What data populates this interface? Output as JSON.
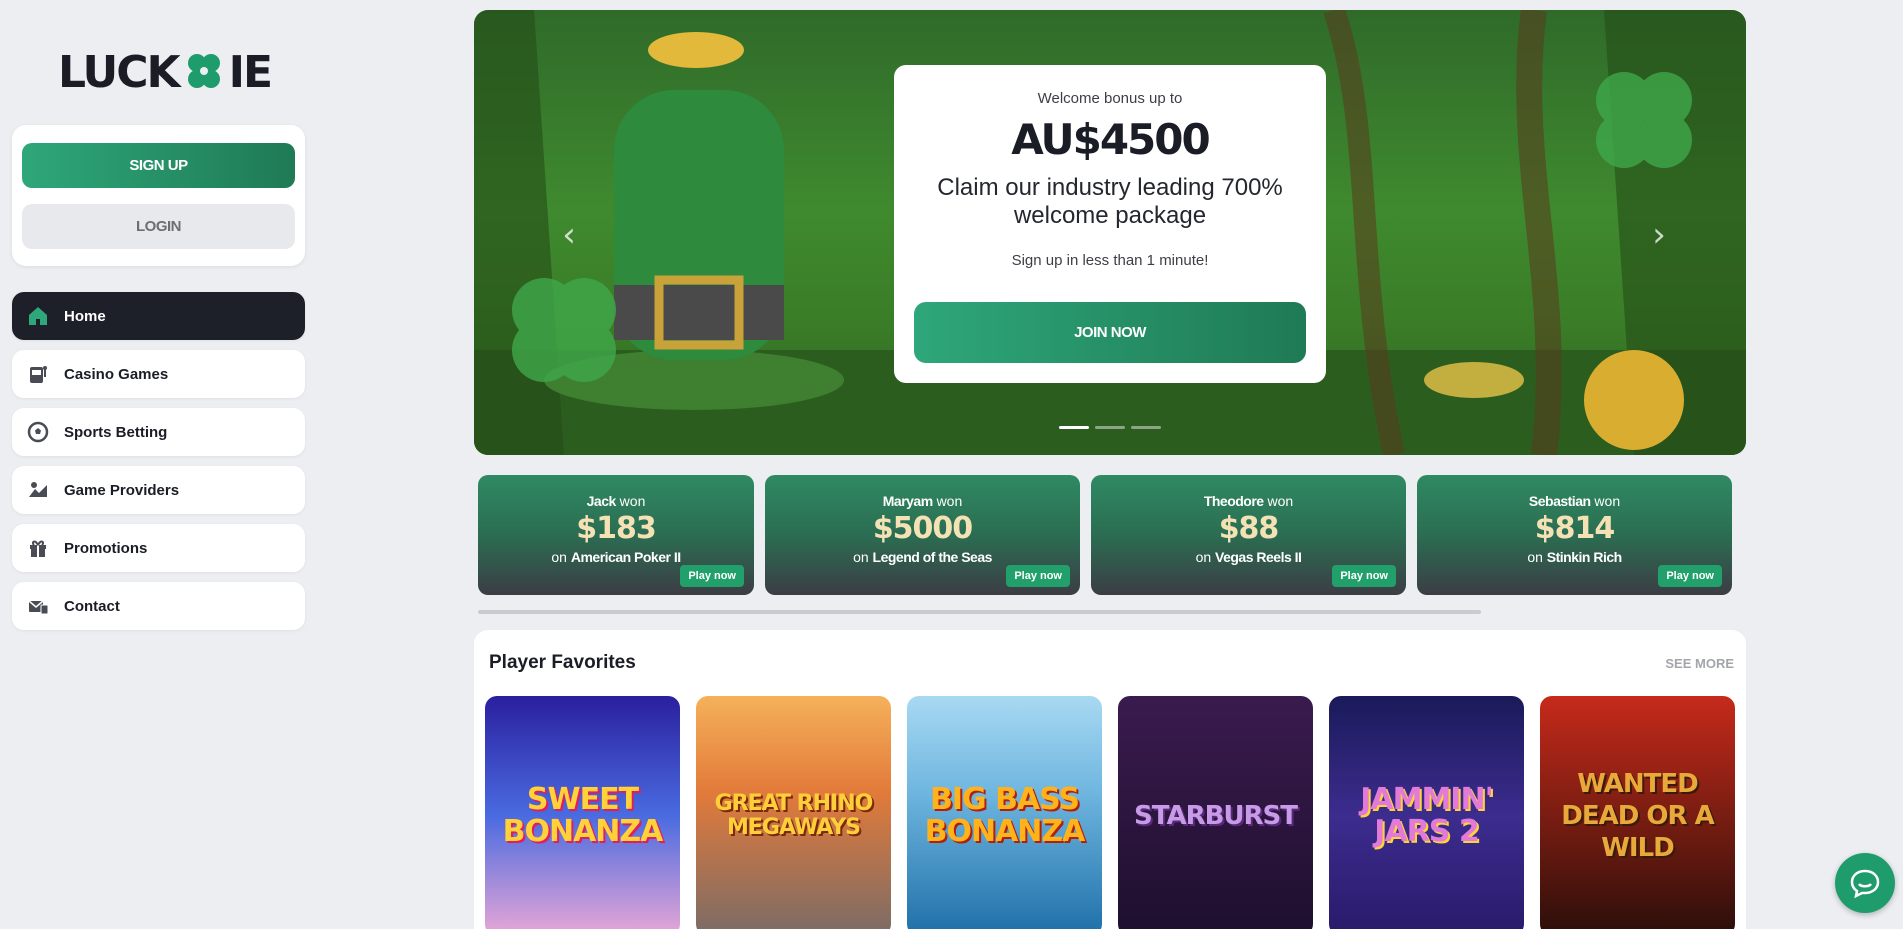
{
  "brand": {
    "logo_left": "LUCK",
    "logo_right": "IE",
    "accent": "#1f9c6b"
  },
  "auth": {
    "signup_label": "SIGN UP",
    "login_label": "LOGIN"
  },
  "nav": {
    "items": [
      {
        "label": "Home",
        "icon": "home-icon",
        "active": true
      },
      {
        "label": "Casino Games",
        "icon": "slot-machine-icon",
        "active": false
      },
      {
        "label": "Sports Betting",
        "icon": "soccer-ball-icon",
        "active": false
      },
      {
        "label": "Game Providers",
        "icon": "providers-icon",
        "active": false
      },
      {
        "label": "Promotions",
        "icon": "gift-icon",
        "active": false
      },
      {
        "label": "Contact",
        "icon": "contact-icon",
        "active": false
      }
    ]
  },
  "hero": {
    "welcome": "Welcome bonus up to",
    "amount": "AU$4500",
    "claim": "Claim our industry leading 700% welcome package",
    "subtext": "Sign up in less than 1 minute!",
    "cta": "JOIN NOW",
    "prev_icon": "chevron-left-icon",
    "next_icon": "chevron-right-icon",
    "slides": 3,
    "active_slide": 1
  },
  "winners": [
    {
      "name": "Jack",
      "won": "won",
      "amount": "$183",
      "on": "on",
      "game": "American Poker II",
      "play": "Play now"
    },
    {
      "name": "Maryam",
      "won": "won",
      "amount": "$5000",
      "on": "on",
      "game": "Legend of the Seas",
      "play": "Play now"
    },
    {
      "name": "Theodore",
      "won": "won",
      "amount": "$88",
      "on": "on",
      "game": "Vegas Reels II",
      "play": "Play now"
    },
    {
      "name": "Sebastian",
      "won": "won",
      "amount": "$814",
      "on": "on",
      "game": "Stinkin Rich",
      "play": "Play now"
    }
  ],
  "favorites": {
    "title": "Player Favorites",
    "see_more": "SEE MORE",
    "games": [
      {
        "title": "SWEET BONANZA"
      },
      {
        "title": "GREAT RHINO MEGAWAYS"
      },
      {
        "title": "BIG BASS BONANZA"
      },
      {
        "title": "STARBURST"
      },
      {
        "title": "JAMMIN' JARS 2"
      },
      {
        "title": "WANTED DEAD OR A WILD"
      }
    ]
  },
  "chat": {
    "icon": "chat-bubble-icon"
  }
}
